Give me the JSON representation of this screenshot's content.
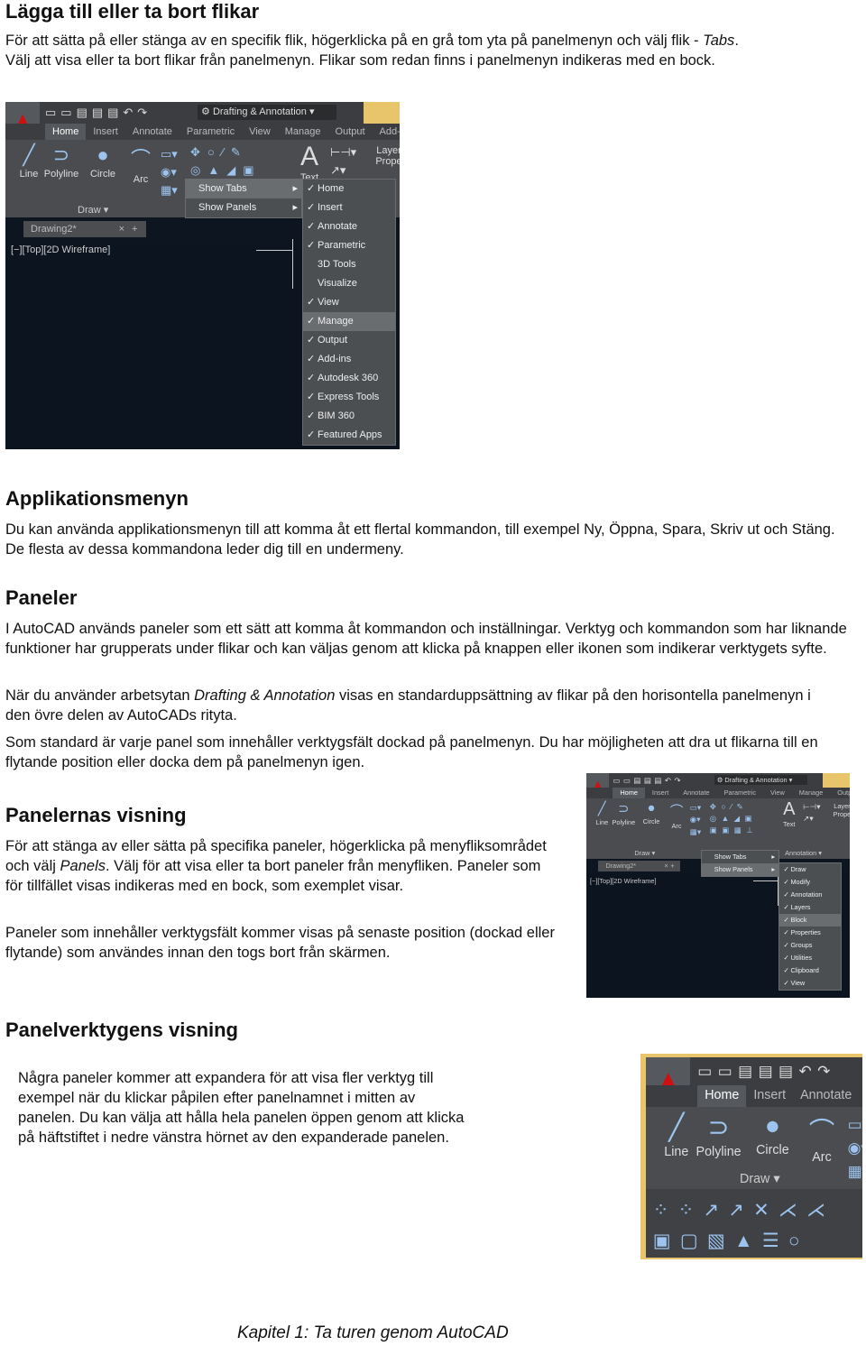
{
  "sections": {
    "tabs_heading": "Lägga till eller ta bort flikar",
    "tabs_p1a": "För att sätta på eller stänga av en specifik flik, högerklicka på en grå tom yta på panelmenyn och välj flik - ",
    "tabs_p1b": "Tabs",
    "tabs_p1c": ".",
    "tabs_p2": "Välj att visa eller ta bort flikar från panelmenyn. Flikar som redan finns i panelmenyn indikeras med en bock.",
    "app_heading": "Applikationsmenyn",
    "app_p": "Du kan använda applikationsmenyn till att komma åt ett flertal kommandon, till exempel Ny, Öppna, Spara, Skriv ut och Stäng. De flesta av dessa kommandona leder dig till en undermeny.",
    "panels_heading": "Paneler",
    "panels_p1": "I AutoCAD används paneler som ett sätt att komma åt kommandon och inställningar. Verktyg och kommandon som har liknande funktioner har grupperats under flikar och kan väljas genom att klicka på knappen eller ikonen som indikerar verktygets syfte.",
    "panels_p2a": "När du använder arbetsytan ",
    "panels_p2b": "Drafting & Annotation",
    "panels_p2c": " visas en standarduppsättning av flikar på den horisontella panelmenyn i den övre delen av AutoCADs rityta.",
    "panels_p3": "Som standard är varje panel som innehåller verktygsfält dockad på panelmenyn. Du har möjligheten att dra ut flikarna till en flytande position eller docka dem på panelmenyn igen.",
    "vis_heading": "Panelernas visning",
    "vis_p1a": "För att stänga av eller sätta på specifika paneler, högerklicka på menyfliksområdet och välj ",
    "vis_p1b": "Panels",
    "vis_p1c": ". Välj för att visa eller ta bort paneler från menyfliken. Paneler som för tillfället visas indikeras med en bock, som exemplet visar.",
    "vis_p2": "Paneler som innehåller verktygsfält kommer visas på senaste position (dockad eller flytande) som användes innan den togs bort från skärmen.",
    "tools_heading": "Panelverktygens visning",
    "tools_p": "Några paneler kommer att expandera för att visa fler verktyg till exempel när du klickar påpilen efter panelnamnet i mitten av panelen. Du kan välja att hålla hela panelen öppen genom att klicka på häftstiftet i nedre vänstra hörnet av den expanderade panelen."
  },
  "footer": "Kapitel 1: Ta turen genom AutoCAD",
  "autocad": {
    "workspace": "Drafting & Annotation",
    "ribbon_tabs": [
      "Home",
      "Insert",
      "Annotate",
      "Parametric",
      "View",
      "Manage",
      "Output",
      "Add-"
    ],
    "draw_tools": [
      "Line",
      "Polyline",
      "Circle",
      "Arc"
    ],
    "text_tool": "Text",
    "layer_tool": "Layer Prope",
    "panel_draw": "Draw",
    "panel_modify": "Modify",
    "panel_annotation": "Annotation",
    "drawing_tab": "Drawing2*",
    "viewport_label": "[−][Top][2D Wireframe]",
    "context_menu": [
      "Show Tabs",
      "Show Panels"
    ],
    "tabs_submenu": [
      {
        "label": "Home",
        "checked": true
      },
      {
        "label": "Insert",
        "checked": true
      },
      {
        "label": "Annotate",
        "checked": true
      },
      {
        "label": "Parametric",
        "checked": true
      },
      {
        "label": "3D Tools",
        "checked": false
      },
      {
        "label": "Visualize",
        "checked": false
      },
      {
        "label": "View",
        "checked": true
      },
      {
        "label": "Manage",
        "checked": true
      },
      {
        "label": "Output",
        "checked": true
      },
      {
        "label": "Add-ins",
        "checked": true
      },
      {
        "label": "Autodesk 360",
        "checked": true
      },
      {
        "label": "Express Tools",
        "checked": true
      },
      {
        "label": "BIM 360",
        "checked": true
      },
      {
        "label": "Featured Apps",
        "checked": true
      }
    ],
    "panels_submenu": [
      {
        "label": "Draw",
        "checked": true
      },
      {
        "label": "Modify",
        "checked": true
      },
      {
        "label": "Annotation",
        "checked": true
      },
      {
        "label": "Layers",
        "checked": true
      },
      {
        "label": "Block",
        "checked": true
      },
      {
        "label": "Properties",
        "checked": true
      },
      {
        "label": "Groups",
        "checked": true
      },
      {
        "label": "Utilities",
        "checked": true
      },
      {
        "label": "Clipboard",
        "checked": true
      },
      {
        "label": "View",
        "checked": true
      }
    ]
  }
}
